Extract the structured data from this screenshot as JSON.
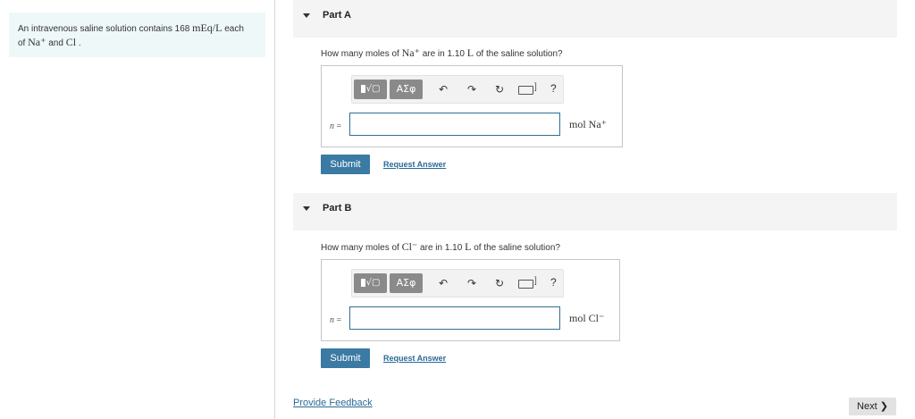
{
  "intro": {
    "t1": "An intravenous saline solution contains 168",
    "conc": "mEq/L",
    "t2": "each",
    "t3": "of",
    "ion1": "Na⁺",
    "t4": "and",
    "ion2": "Cl",
    "t5": "."
  },
  "toolbar": {
    "template_label": "√▢",
    "symbols_label": "ΑΣφ",
    "undo": "↶",
    "redo": "↷",
    "reset": "↻",
    "keyboard_bracket": "]",
    "help": "?"
  },
  "partA": {
    "title": "Part A",
    "q1": "How many moles of",
    "ion": "Na⁺",
    "q2": "are in 1.10",
    "unitL": "L",
    "q3": "of the saline solution?",
    "n_label": "n",
    "eq": "=",
    "input_value": "",
    "unit": "mol Na⁺",
    "submit": "Submit",
    "request": "Request Answer"
  },
  "partB": {
    "title": "Part B",
    "q1": "How many moles of",
    "ion": "Cl⁻",
    "q2": "are in 1.10",
    "unitL": "L",
    "q3": "of the saline solution?",
    "n_label": "n",
    "eq": "=",
    "input_value": "",
    "unit": "mol Cl⁻",
    "submit": "Submit",
    "request": "Request Answer"
  },
  "footer": {
    "feedback": "Provide Feedback",
    "next": "Next",
    "next_icon": "❯"
  }
}
